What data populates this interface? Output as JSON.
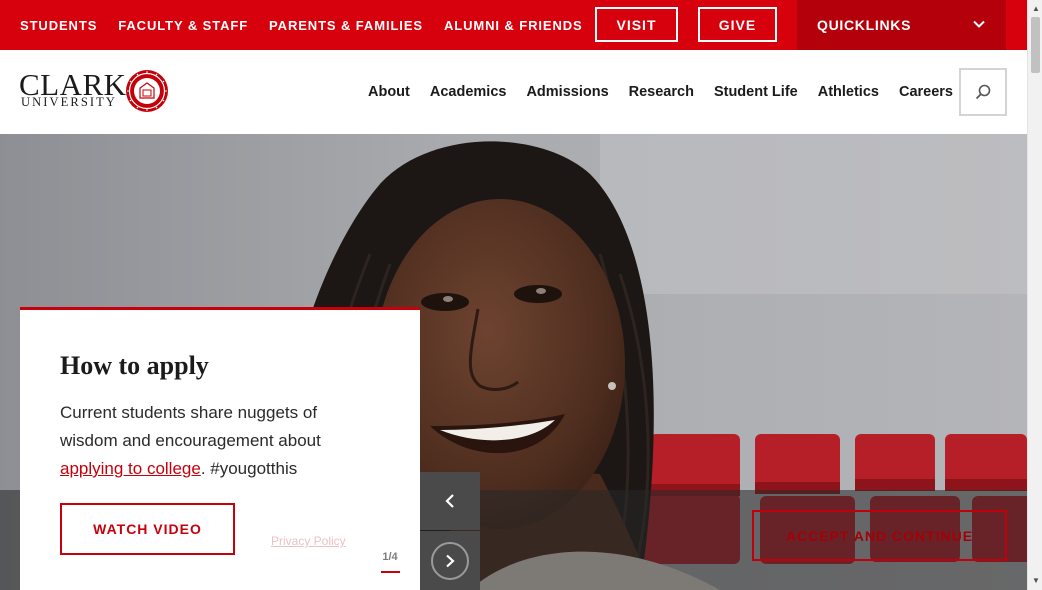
{
  "topbar": {
    "links": [
      "STUDENTS",
      "FACULTY & STAFF",
      "PARENTS & FAMILIES",
      "ALUMNI & FRIENDS"
    ],
    "visit_label": "VISIT",
    "give_label": "GIVE",
    "quicklinks_label": "QUICKLINKS",
    "brand_red": "#d7000d"
  },
  "header": {
    "logo_primary": "CLARK",
    "logo_secondary": "UNIVERSITY",
    "nav": [
      "About",
      "Academics",
      "Admissions",
      "Research",
      "Student Life",
      "Athletics",
      "Careers"
    ],
    "search_icon": "search-icon"
  },
  "card": {
    "title": "How to apply",
    "body_before": "Current students share nuggets of wisdom and encouragement about ",
    "body_link": "applying to college",
    "body_after": ". #yougotthis",
    "button_label": "WATCH VIDEO",
    "pager": "1/4"
  },
  "cookie": {
    "privacy_label": "Privacy Policy",
    "accept_label": "ACCEPT AND CONTINUE"
  },
  "slider": {
    "prev_icon": "chevron-left-icon",
    "next_icon": "chevron-right-icon"
  }
}
